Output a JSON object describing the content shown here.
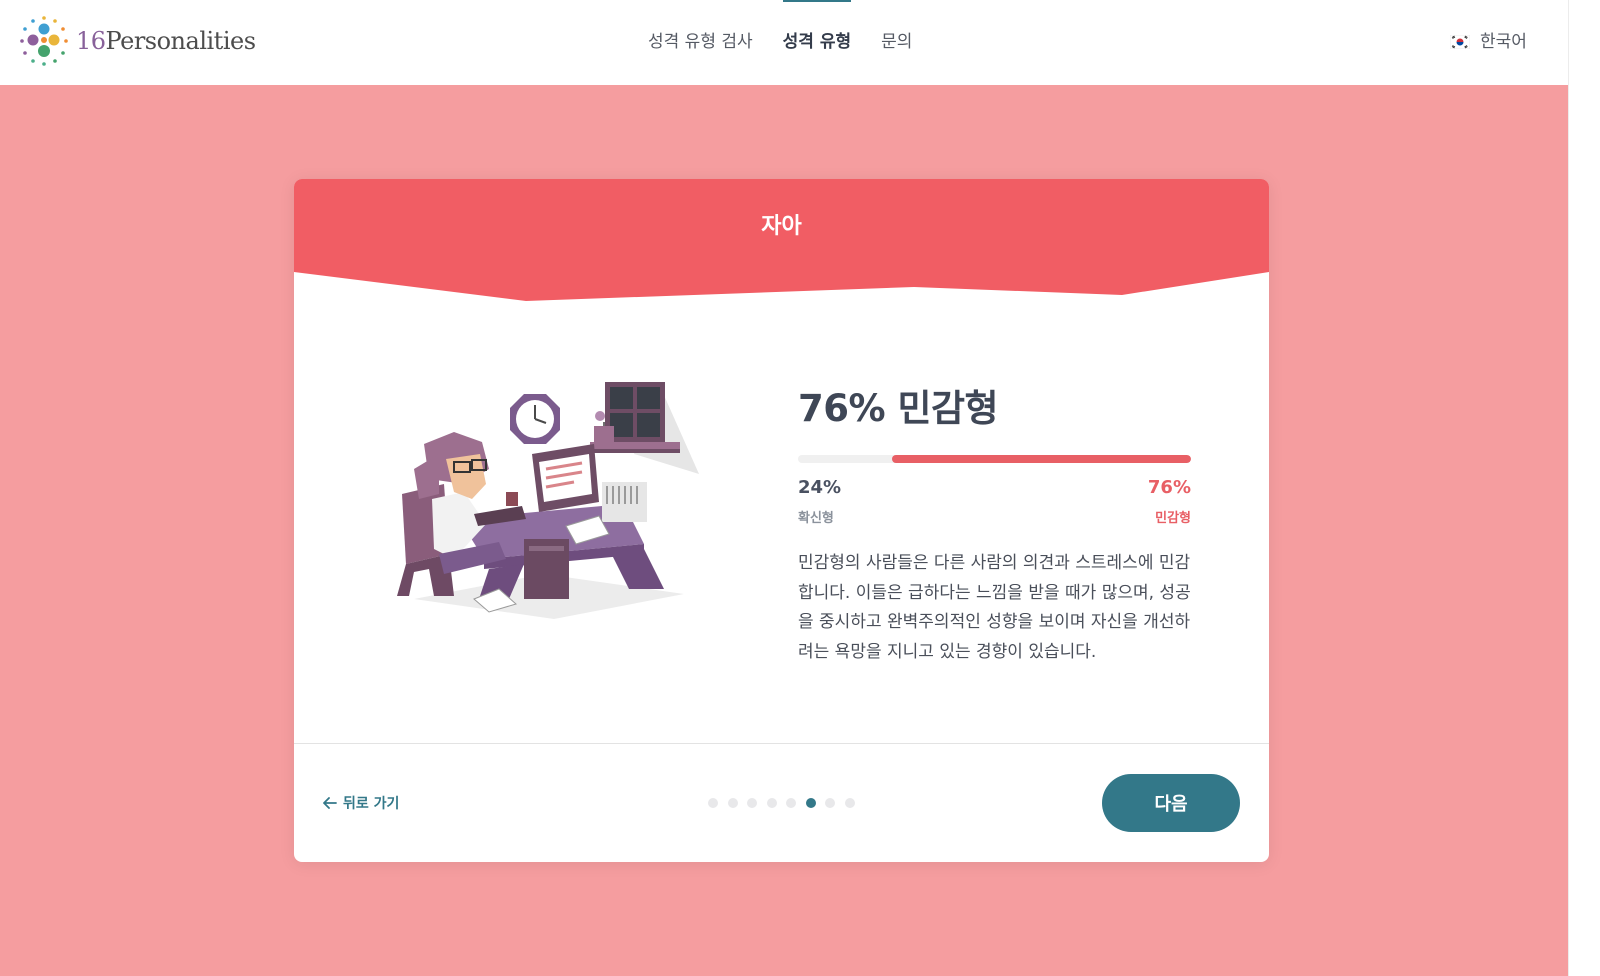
{
  "header": {
    "logo_number": "16",
    "logo_text": "Personalities",
    "nav": [
      {
        "label": "성격 유형 검사",
        "active": false
      },
      {
        "label": "성격 유형",
        "active": true
      },
      {
        "label": "문의",
        "active": false
      }
    ],
    "language": "한국어",
    "language_icon": "korea-flag-icon"
  },
  "card": {
    "title": "자아",
    "result_title": "76% 민감형",
    "progress": {
      "left_percent": 24,
      "right_percent": 76
    },
    "left_pct_label": "24%",
    "left_trait": "확신형",
    "right_pct_label": "76%",
    "right_trait": "민감형",
    "description": "민감형의 사람들은 다른 사람의 의견과 스트레스에 민감합니다. 이들은 급하다는 느낌을 받을 때가 많으며, 성공을 중시하고 완벽주의적인 성향을 보이며 자신을 개선하려는 욕망을 지니고 있는 경향이 있습니다.",
    "back_label": "뒤로 가기",
    "next_label": "다음",
    "pagination": {
      "total": 8,
      "current": 6
    }
  },
  "colors": {
    "background": "#f59d9f",
    "header_accent": "#f15d64",
    "progress_fill": "#e85f65",
    "primary": "#337889"
  }
}
